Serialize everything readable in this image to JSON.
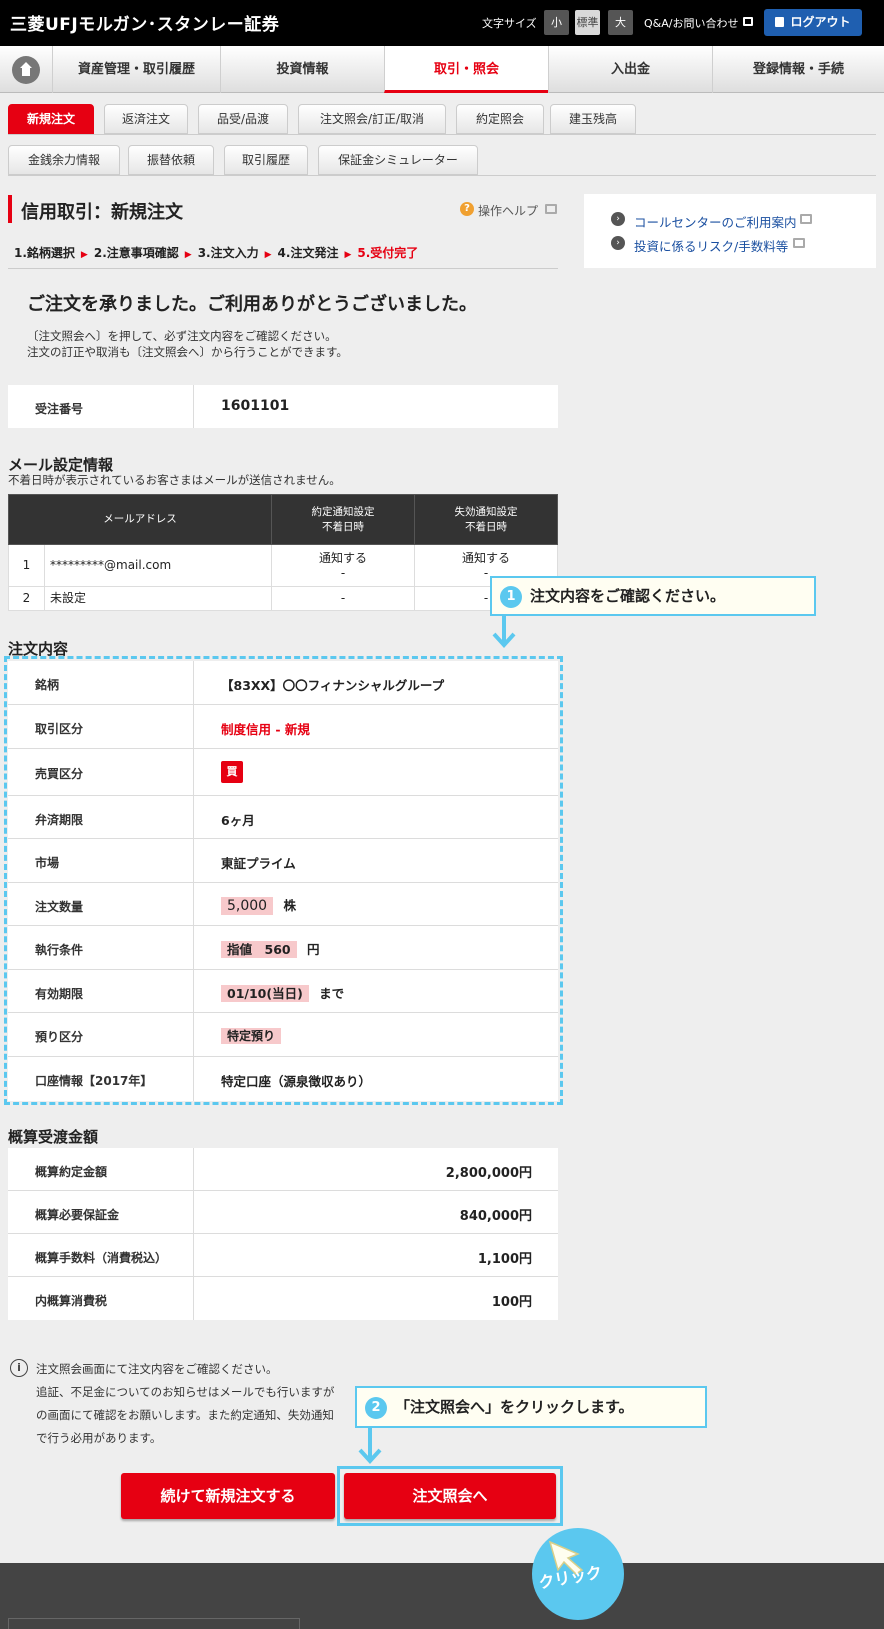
{
  "header": {
    "logo": "三菱UFJモルガン･スタンレー証券",
    "font_size_label": "文字サイズ",
    "font_sizes": [
      "小",
      "標準",
      "大"
    ],
    "qa_link": "Q&A/お問い合わせ",
    "logout": "ログアウト"
  },
  "global_nav": [
    "資産管理・取引履歴",
    "投資情報",
    "取引・照会",
    "入出金",
    "登録情報・手続"
  ],
  "sub_tabs_row1": [
    "新規注文",
    "返済注文",
    "品受/品渡",
    "注文照会/訂正/取消",
    "約定照会",
    "建玉残高"
  ],
  "sub_tabs_row2": [
    "金銭余力情報",
    "振替依頼",
    "取引履歴",
    "保証金シミュレーター"
  ],
  "page": {
    "title": "信用取引：新規注文",
    "help": "操作ヘルプ",
    "steps": [
      "1.銘柄選択",
      "2.注意事項確認",
      "3.注文入力",
      "4.注文発注",
      "5.受付完了"
    ],
    "thanks": "ご注文を承りました。ご利用ありがとうございました。",
    "note1": "〔注文照会へ〕を押して、必ず注文内容をご確認ください。",
    "note2": "注文の訂正や取消も〔注文照会へ〕から行うことができます。"
  },
  "right_links": [
    "コールセンターのご利用案内",
    "投資に係るリスク/手数料等"
  ],
  "order_number": {
    "label": "受注番号",
    "value": "1601101"
  },
  "mail": {
    "heading": "メール設定情報",
    "note": "不着日時が表示されているお客さまはメールが送信されません。",
    "col_address": "メールアドレス",
    "col_exec_1": "約定通知設定",
    "col_exec_2": "不着日時",
    "col_expire_1": "失効通知設定",
    "col_expire_2": "不着日時",
    "rows": [
      {
        "no": "1",
        "address": "*********@mail.com",
        "exec": "通知する",
        "exec_date": "-",
        "expire": "通知する",
        "expire_date": "-"
      },
      {
        "no": "2",
        "address": "未設定",
        "exec": "-",
        "expire": "-"
      }
    ]
  },
  "callout1": {
    "num": "1",
    "text": "注文内容をご確認ください。"
  },
  "callout2": {
    "num": "2",
    "text": "「注文照会へ」をクリックします。"
  },
  "order": {
    "heading": "注文内容",
    "rows": [
      {
        "label": "銘柄",
        "value": "【83XX】〇〇フィナンシャルグループ"
      },
      {
        "label": "取引区分",
        "value": "制度信用 - 新規"
      },
      {
        "label": "売買区分",
        "value": "買"
      },
      {
        "label": "弁済期限",
        "value": "6ヶ月"
      },
      {
        "label": "市場",
        "value": "東証プライム"
      },
      {
        "label": "注文数量",
        "value": "5,000",
        "unit": "株"
      },
      {
        "label": "執行条件",
        "value": "指値　560",
        "unit": "円"
      },
      {
        "label": "有効期限",
        "value": "01/10(当日)",
        "unit": "まで"
      },
      {
        "label": "預り区分",
        "value": "特定預り"
      },
      {
        "label": "口座情報【2017年】",
        "value": "特定口座（源泉徴収あり）"
      }
    ]
  },
  "estimate": {
    "heading": "概算受渡金額",
    "rows": [
      {
        "label": "概算約定金額",
        "value": "2,800,000円"
      },
      {
        "label": "概算必要保証金",
        "value": "840,000円"
      },
      {
        "label": "概算手数料（消費税込）",
        "value": "1,100円"
      },
      {
        "label": "内概算消費税",
        "value": "100円"
      }
    ]
  },
  "info": {
    "line1": "注文照会画面にて注文内容をご確認ください。",
    "line2": "追証、不足金についてのお知らせはメールでも行いますが",
    "line3": "の画面にて確認をお願いします。また約定通知、失効通知",
    "line4": "で行う必用があります。"
  },
  "buttons": {
    "continue": "続けて新規注文する",
    "inquiry": "注文照会へ"
  },
  "click_label": "クリック",
  "colors": {
    "accent": "#e60012",
    "callout": "#5bc8ef",
    "link": "#1a4fa0"
  }
}
